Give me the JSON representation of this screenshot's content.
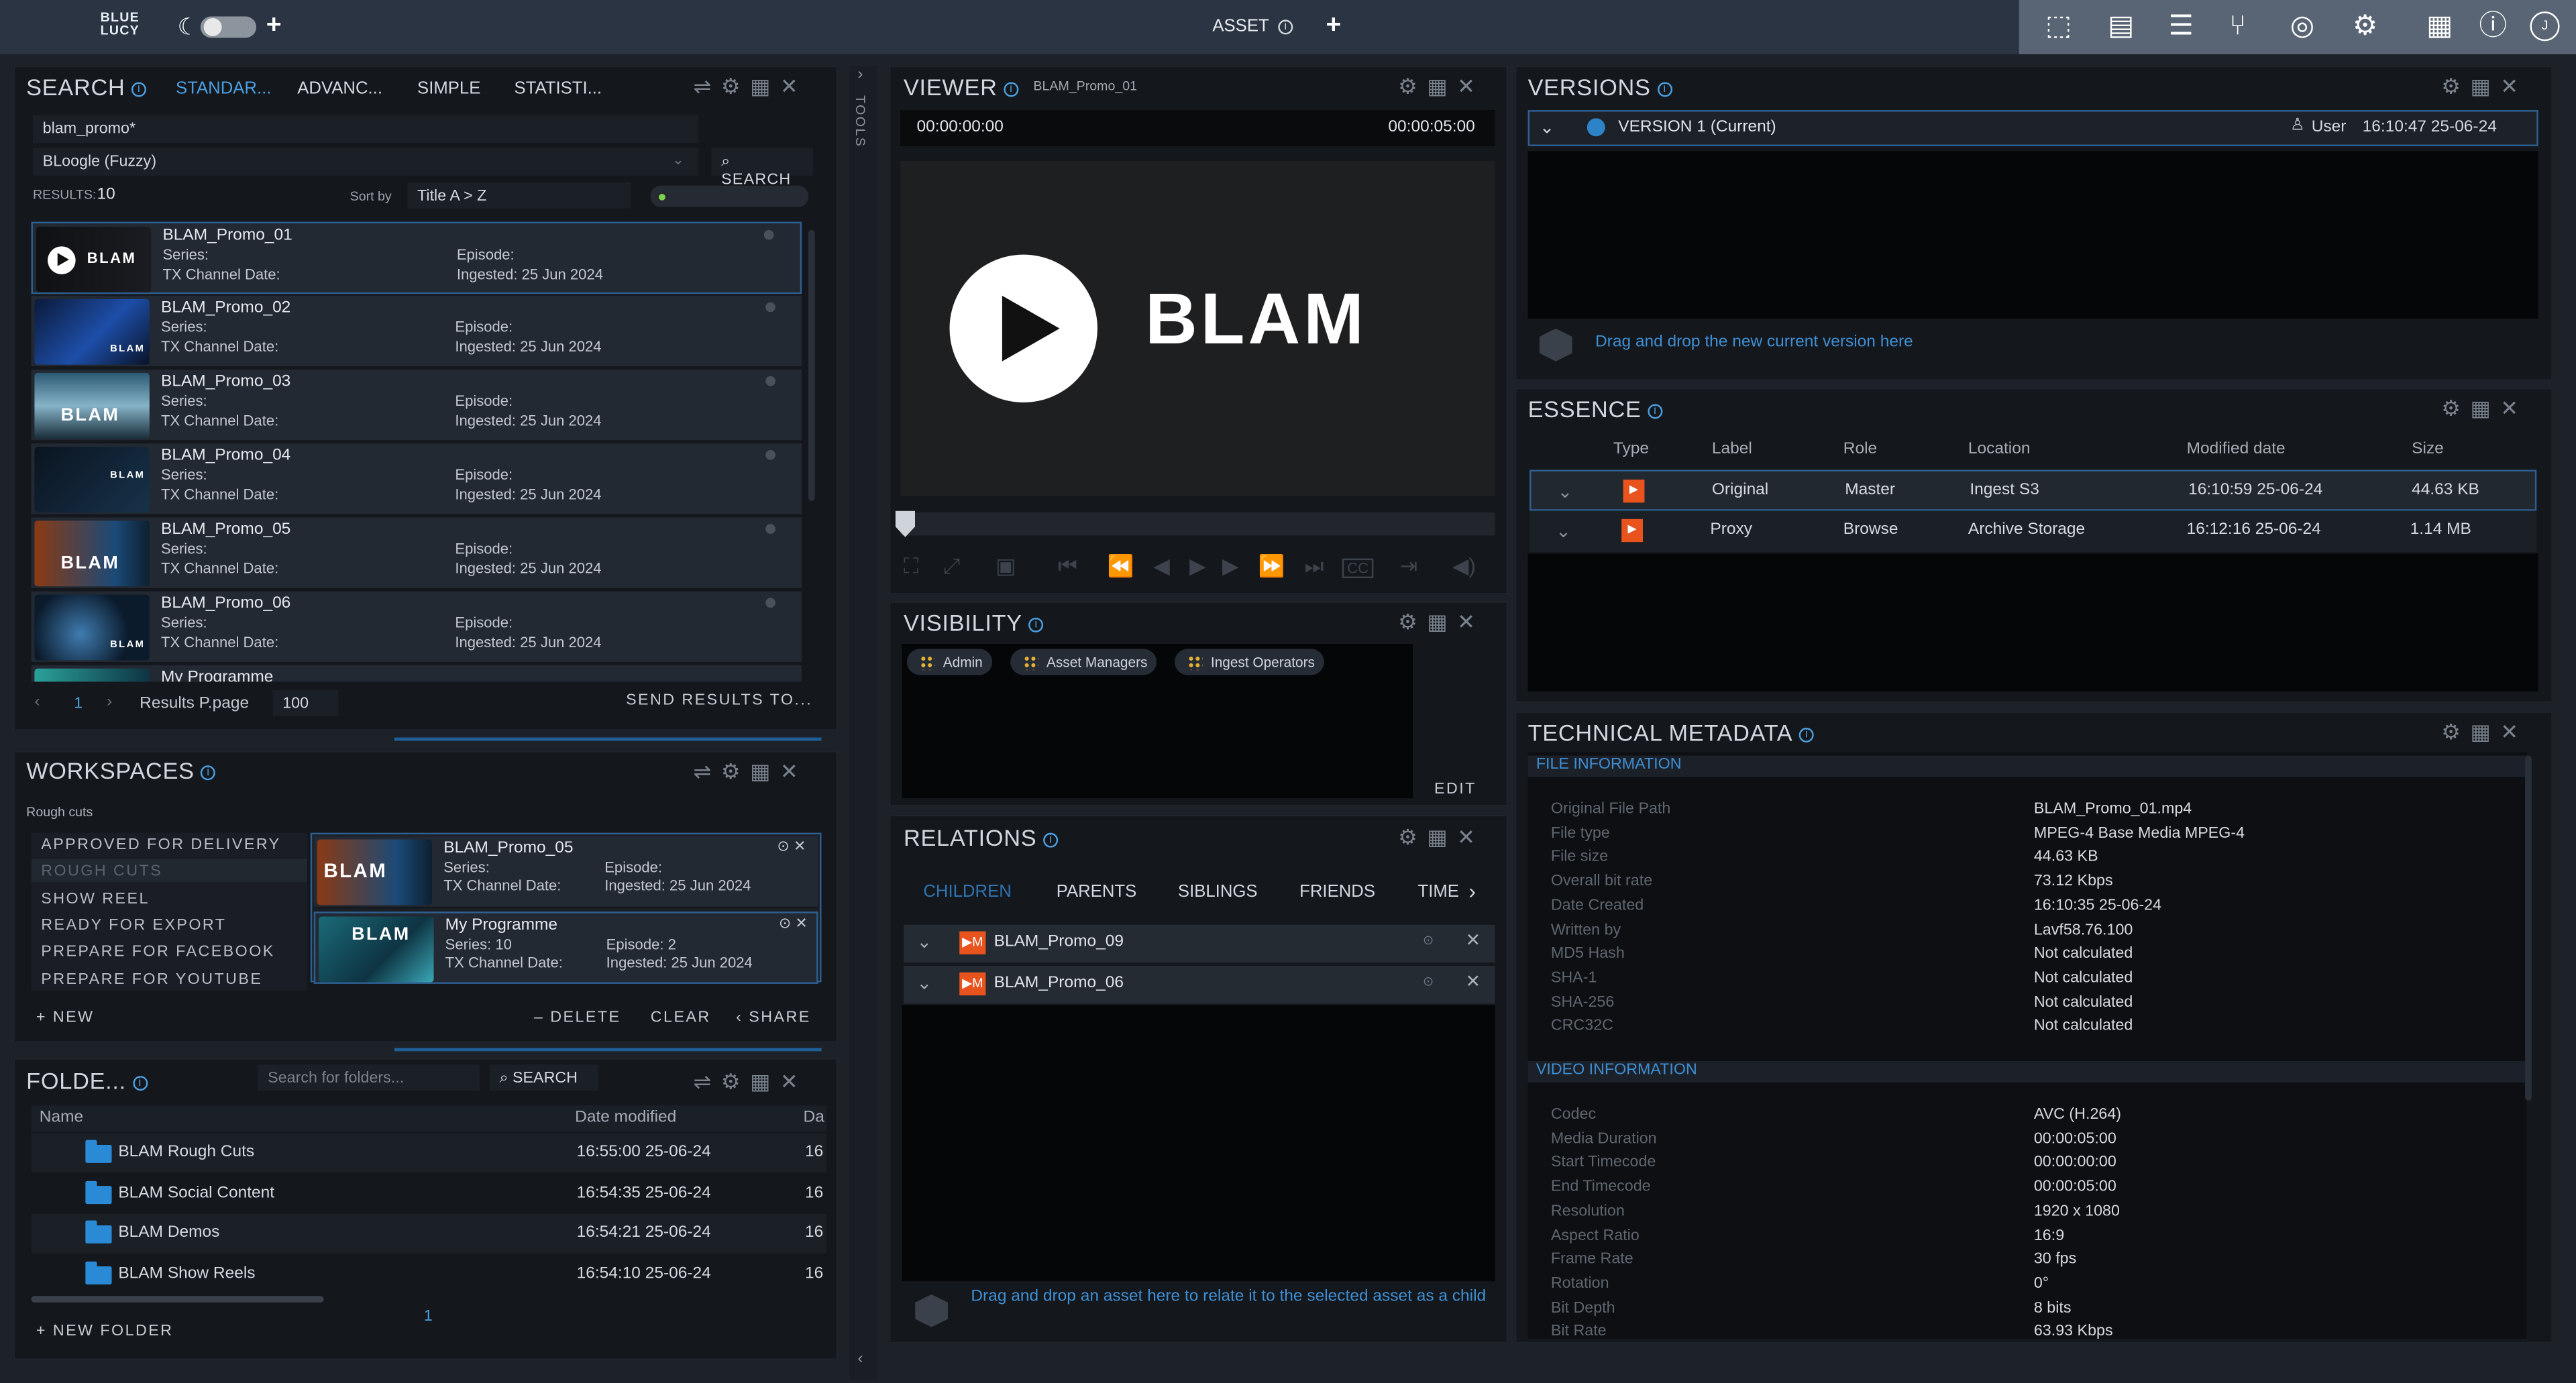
{
  "topbar": {
    "logo_line1": "BLUE",
    "logo_line2": "LUCY",
    "center_label": "ASSET"
  },
  "search": {
    "title": "SEARCH",
    "tabs": [
      "STANDAR...",
      "ADVANC...",
      "SIMPLE",
      "STATISTI..."
    ],
    "query": "blam_promo*",
    "engine": "BLoogle (Fuzzy)",
    "search_btn": "SEARCH",
    "results_label": "RESULTS:",
    "results_count": "10",
    "sort_label": "Sort by",
    "sort_value": "Title A > Z",
    "page": "1",
    "per_page_label": "Results P.page",
    "per_page": "100",
    "send_results": "SEND RESULTS TO...",
    "items": [
      {
        "title": "BLAM_Promo_01",
        "series": "Series:",
        "tx": "TX Channel Date:",
        "episode": "Episode:",
        "ingested": "Ingested: 25 Jun 2024"
      },
      {
        "title": "BLAM_Promo_02",
        "series": "Series:",
        "tx": "TX Channel Date:",
        "episode": "Episode:",
        "ingested": "Ingested: 25 Jun 2024"
      },
      {
        "title": "BLAM_Promo_03",
        "series": "Series:",
        "tx": "TX Channel Date:",
        "episode": "Episode:",
        "ingested": "Ingested: 25 Jun 2024"
      },
      {
        "title": "BLAM_Promo_04",
        "series": "Series:",
        "tx": "TX Channel Date:",
        "episode": "Episode:",
        "ingested": "Ingested: 25 Jun 2024"
      },
      {
        "title": "BLAM_Promo_05",
        "series": "Series:",
        "tx": "TX Channel Date:",
        "episode": "Episode:",
        "ingested": "Ingested: 25 Jun 2024"
      },
      {
        "title": "BLAM_Promo_06",
        "series": "Series:",
        "tx": "TX Channel Date:",
        "episode": "Episode:",
        "ingested": "Ingested: 25 Jun 2024"
      },
      {
        "title": "My Programme"
      }
    ]
  },
  "workspaces": {
    "title": "WORKSPACES",
    "current": "Rough cuts",
    "list": [
      "APPROVED FOR DELIVERY",
      "ROUGH CUTS",
      "SHOW REEL",
      "READY FOR EXPORT",
      "PREPARE FOR FACEBOOK",
      "PREPARE FOR YOUTUBE"
    ],
    "cards": [
      {
        "title": "BLAM_Promo_05",
        "series": "Series:",
        "tx": "TX Channel Date:",
        "episode": "Episode:",
        "ingested": "Ingested: 25 Jun 2024"
      },
      {
        "title": "My Programme",
        "series": "Series: 10",
        "tx": "TX Channel Date:",
        "episode": "Episode: 2",
        "ingested": "Ingested: 25 Jun 2024"
      }
    ],
    "new": "NEW",
    "delete": "DELETE",
    "clear": "CLEAR",
    "share": "SHARE"
  },
  "folders": {
    "title": "FOLDE...",
    "placeholder": "Search for folders...",
    "search_btn": "SEARCH",
    "col_name": "Name",
    "col_date": "Date modified",
    "col_more": "Da",
    "rows": [
      {
        "name": "BLAM Rough Cuts",
        "date": "16:55:00 25-06-24",
        "more": "16"
      },
      {
        "name": "BLAM Social Content",
        "date": "16:54:35 25-06-24",
        "more": "16"
      },
      {
        "name": "BLAM Demos",
        "date": "16:54:21 25-06-24",
        "more": "16"
      },
      {
        "name": "BLAM Show Reels",
        "date": "16:54:10 25-06-24",
        "more": "16"
      }
    ],
    "page": "1",
    "new_folder": "NEW FOLDER"
  },
  "tools_label": "TOOLS",
  "viewer": {
    "title": "VIEWER",
    "asset": "BLAM_Promo_01",
    "tc_start": "00:00:00:00",
    "tc_end": "00:00:05:00",
    "brand": "BLAM"
  },
  "visibility": {
    "title": "VISIBILITY",
    "chips": [
      "Admin",
      "Asset Managers",
      "Ingest Operators"
    ],
    "edit": "EDIT"
  },
  "relations": {
    "title": "RELATIONS",
    "tabs": [
      "CHILDREN",
      "PARENTS",
      "SIBLINGS",
      "FRIENDS",
      "TIME"
    ],
    "rows": [
      "BLAM_Promo_09",
      "BLAM_Promo_06"
    ],
    "drop_text": "Drag and drop an asset here to relate it to the selected asset as a child"
  },
  "versions": {
    "title": "VERSIONS",
    "version": "VERSION 1 (Current)",
    "user": "User",
    "time": "16:10:47 25-06-24",
    "drop_text": "Drag and drop the new current version here"
  },
  "essence": {
    "title": "ESSENCE",
    "headers": [
      "Type",
      "Label",
      "Role",
      "Location",
      "Modified date",
      "Size"
    ],
    "rows": [
      {
        "label": "Original",
        "role": "Master",
        "location": "Ingest S3",
        "date": "16:10:59 25-06-24",
        "size": "44.63 KB"
      },
      {
        "label": "Proxy",
        "role": "Browse",
        "location": "Archive Storage",
        "date": "16:12:16 25-06-24",
        "size": "1.14 MB"
      }
    ]
  },
  "techmeta": {
    "title": "TECHNICAL METADATA",
    "file_section": "FILE INFORMATION",
    "file": [
      [
        "Original File Path",
        "BLAM_Promo_01.mp4"
      ],
      [
        "File type",
        "MPEG-4 Base Media MPEG-4"
      ],
      [
        "File size",
        "44.63 KB"
      ],
      [
        "Overall bit rate",
        "73.12 Kbps"
      ],
      [
        "Date Created",
        "16:10:35 25-06-24"
      ],
      [
        "Written by",
        "Lavf58.76.100"
      ],
      [
        "MD5 Hash",
        "Not calculated"
      ],
      [
        "SHA-1",
        "Not calculated"
      ],
      [
        "SHA-256",
        "Not calculated"
      ],
      [
        "CRC32C",
        "Not calculated"
      ]
    ],
    "video_section": "VIDEO INFORMATION",
    "video": [
      [
        "Codec",
        "AVC (H.264)"
      ],
      [
        "Media Duration",
        "00:00:05:00"
      ],
      [
        "Start Timecode",
        "00:00:00:00"
      ],
      [
        "End Timecode",
        "00:00:05:00"
      ],
      [
        "Resolution",
        "1920 x 1080"
      ],
      [
        "Aspect Ratio",
        "16:9"
      ],
      [
        "Frame Rate",
        "30 fps"
      ],
      [
        "Rotation",
        "0°"
      ],
      [
        "Bit Depth",
        "8 bits"
      ],
      [
        "Bit Rate",
        "63.93 Kbps"
      ]
    ]
  },
  "colors": {
    "accent": "#4b9fe0",
    "orange": "#e8531e",
    "topbar": "#2b3442"
  }
}
